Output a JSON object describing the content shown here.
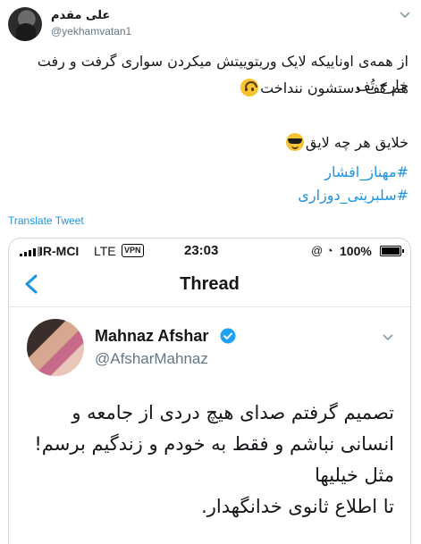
{
  "tweet": {
    "author_name": "علی مقدم",
    "author_handle": "@yekhamvatan1",
    "line1": "از همه‌ی اوناییکه لایک وریتوییتش میکردن سواری گرفت و رفت خارج تُف",
    "line2": "هم کف دستشون ننداخت",
    "line3": "خلایق هر چه لایق",
    "hashtags": [
      "#مهناز_افشار",
      "#سلبریتی_دوزاری"
    ],
    "translate_label": "Translate Tweet"
  },
  "screenshot": {
    "status": {
      "carrier": "IR-MCI",
      "network": "LTE",
      "vpn": "VPN",
      "time": "23:03",
      "battery_pct": "100%"
    },
    "nav_title": "Thread",
    "author_name": "Mahnaz Afshar",
    "author_handle": "@AfsharMahnaz",
    "lines": [
      "تصمیم گرفتم صدای هیچ دردی از جامعه و",
      "انسانی نباشم و فقط به خودم و زندگیم برسم!",
      "مثل خیلیها",
      "تا اطلاع ثانوی خدانگهدار."
    ]
  },
  "colors": {
    "link": "#1b95e0",
    "secondary": "#657786",
    "border": "#ccd6dd"
  },
  "icons": [
    "chevron-down-icon",
    "upside-down-face-emoji",
    "sunglasses-emoji",
    "back-chevron-icon",
    "verified-badge-icon"
  ]
}
